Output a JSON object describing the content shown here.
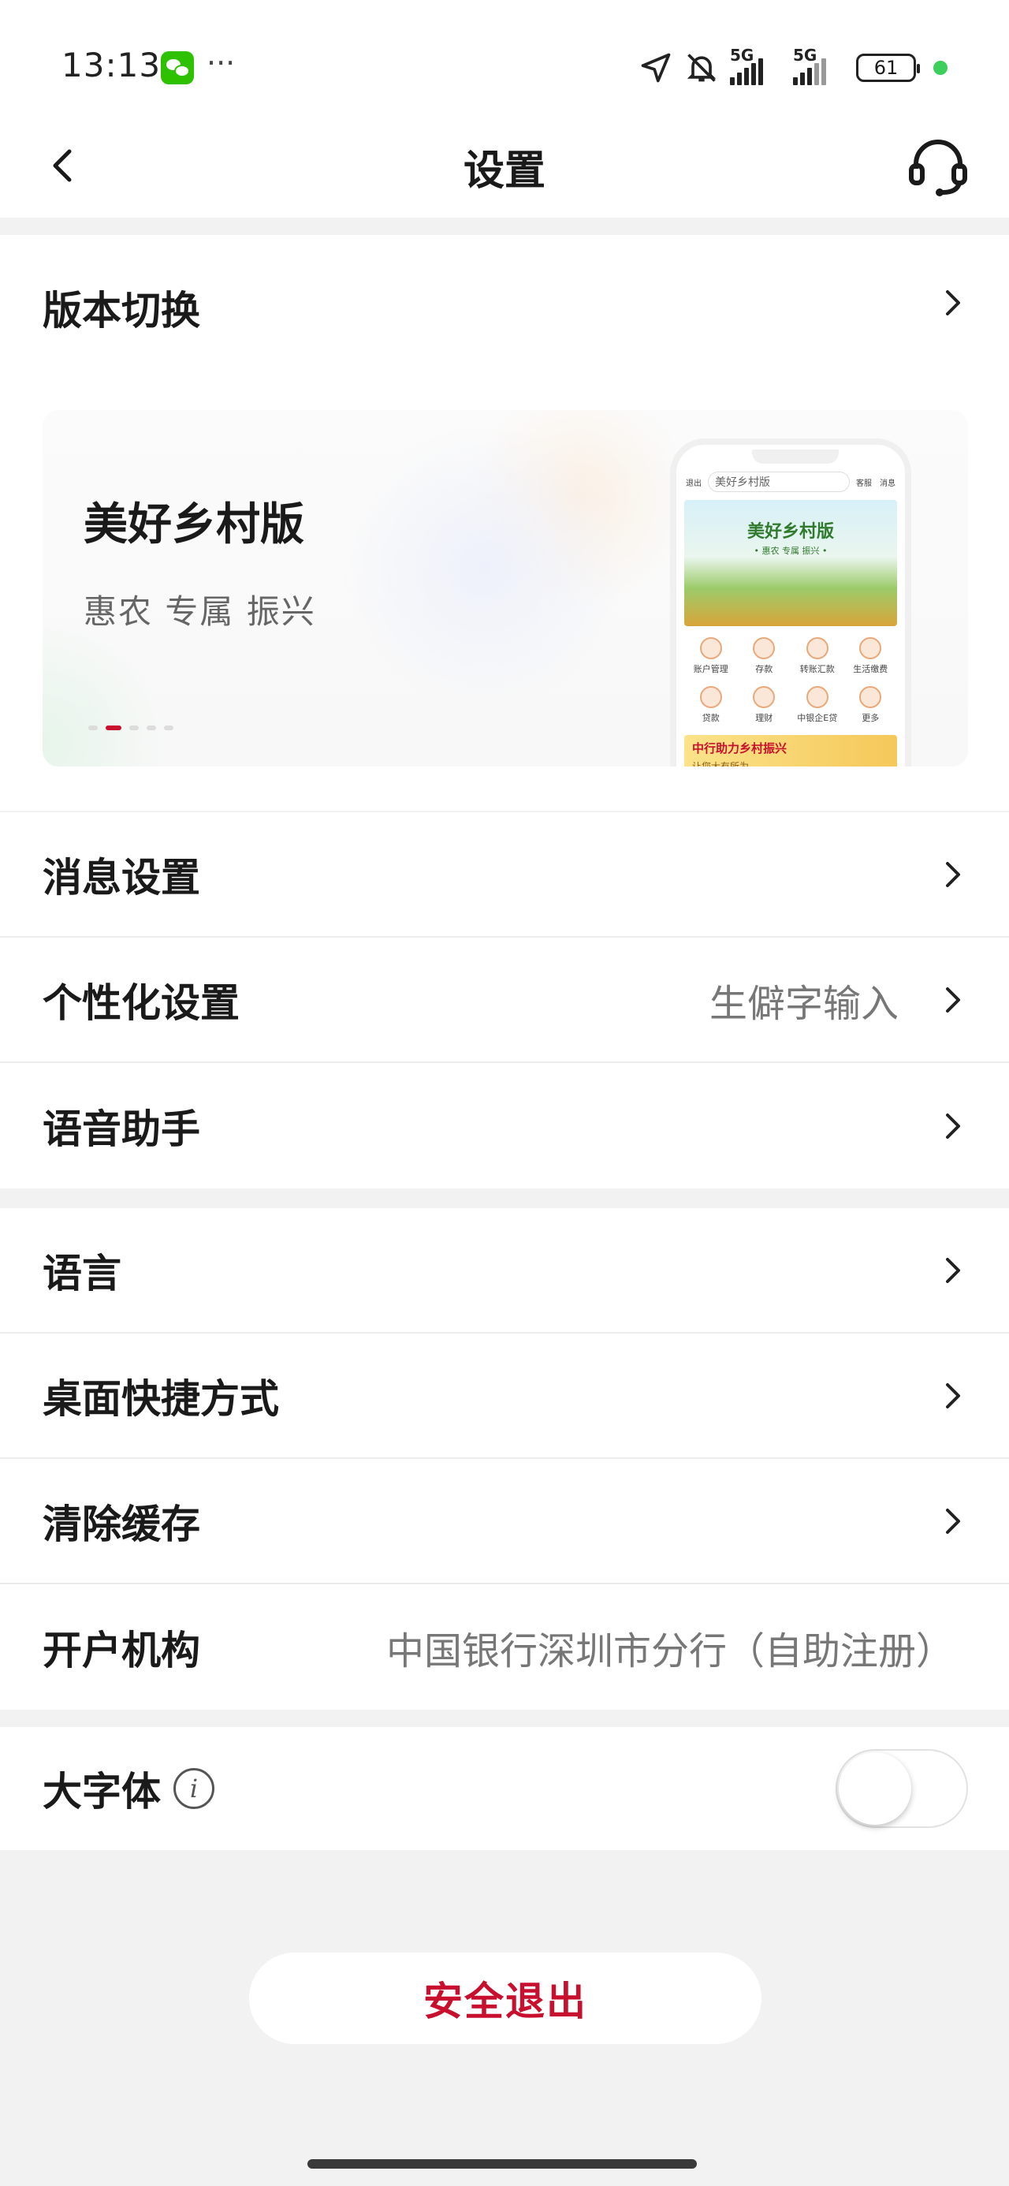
{
  "status_bar": {
    "time": "13:13",
    "more": "···",
    "signal1_label": "5G",
    "signal2_label": "5G",
    "battery": "61"
  },
  "nav": {
    "title": "设置",
    "back_icon": "chevron-left-icon",
    "service_icon": "headset-icon"
  },
  "version": {
    "label": "版本切换",
    "banner": {
      "title": "美好乡村版",
      "subtitle": "惠农 专属 振兴",
      "active_slide": 2,
      "slide_count": 5,
      "phone": {
        "exit": "退出",
        "search_placeholder": "美好乡村版",
        "hero_title": "美好乡村版",
        "hero_sub": "• 惠农 专属 振兴 •",
        "service": "客服",
        "message": "消息",
        "grid": [
          "账户管理",
          "存款",
          "转账汇款",
          "生活缴费",
          "贷款",
          "理财",
          "中银企E贷",
          "更多"
        ],
        "promo_title": "中行助力乡村振兴",
        "promo_sub": "让您大有所为"
      }
    }
  },
  "group1": [
    {
      "label": "消息设置",
      "value": ""
    },
    {
      "label": "个性化设置",
      "value": "生僻字输入"
    },
    {
      "label": "语音助手",
      "value": ""
    }
  ],
  "group2": [
    {
      "label": "语言",
      "value": ""
    },
    {
      "label": "桌面快捷方式",
      "value": ""
    },
    {
      "label": "清除缓存",
      "value": ""
    },
    {
      "label": "开户机构",
      "value": "中国银行深圳市分行（自助注册）"
    }
  ],
  "large_font": {
    "label": "大字体",
    "info_icon": "i",
    "enabled": false
  },
  "logout_label": "安全退出",
  "colors": {
    "accent": "#c8102e",
    "background": "#f2f2f2"
  }
}
